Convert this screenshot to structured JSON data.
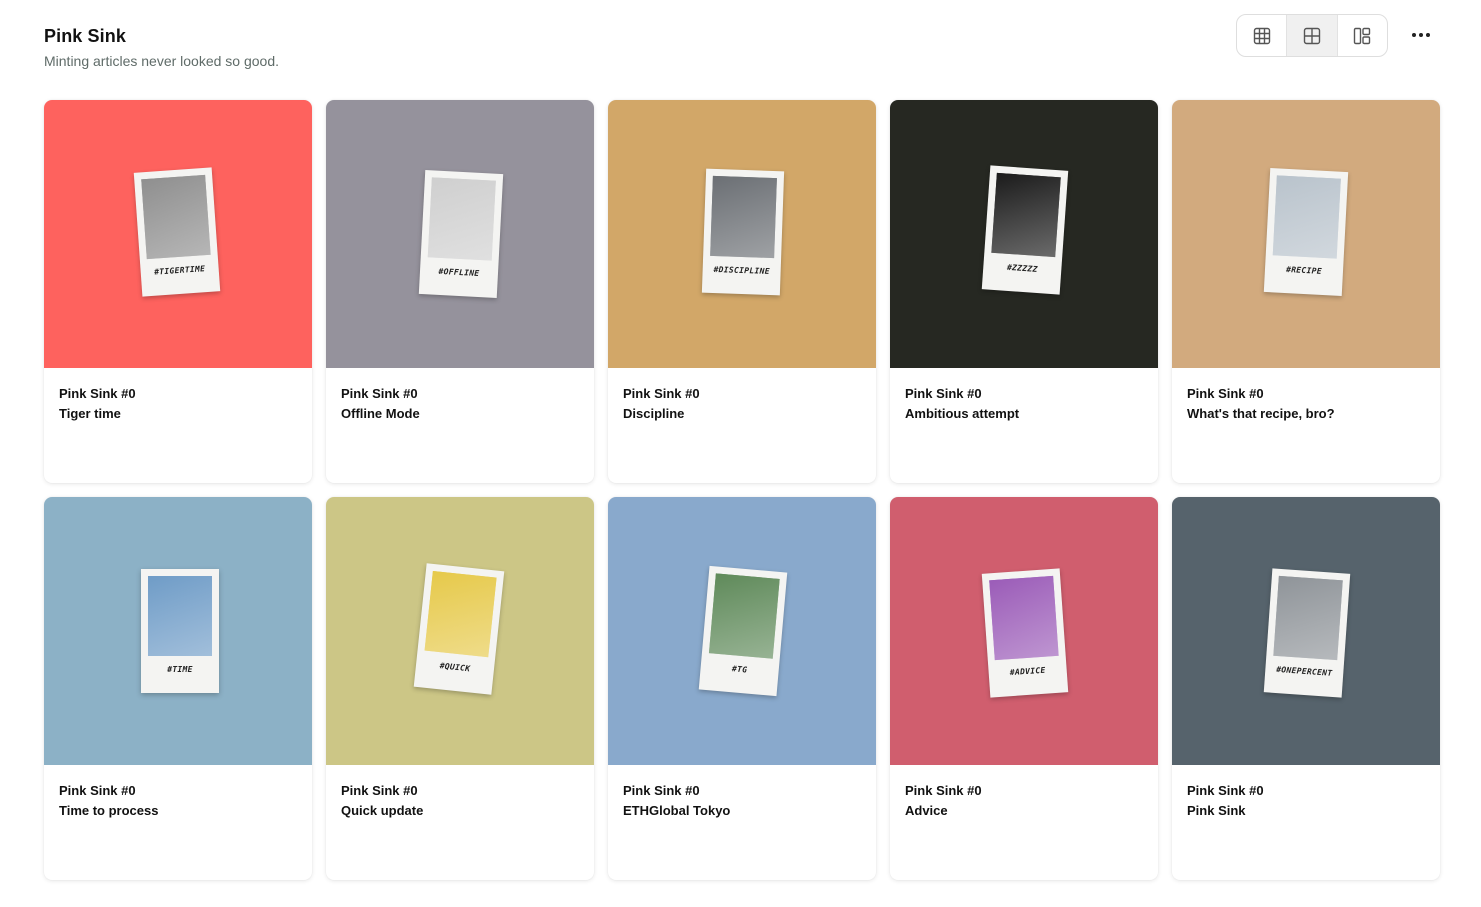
{
  "header": {
    "title": "Pink Sink",
    "subtitle": "Minting articles never looked so good."
  },
  "toolbar": {
    "views": [
      {
        "icon": "grid-small-icon"
      },
      {
        "icon": "grid-large-icon",
        "active": true
      },
      {
        "icon": "layout-icon"
      }
    ],
    "more_icon": "more-dots-icon"
  },
  "cards": [
    {
      "series": "Pink Sink #0",
      "name": "Tiger time",
      "tag": "#TIGERTIME",
      "bg": "#fe625e",
      "photo": "#8f8f8f"
    },
    {
      "series": "Pink Sink #0",
      "name": "Offline Mode",
      "tag": "#OFFLINE",
      "bg": "#95929c",
      "photo": "#cfcfcf"
    },
    {
      "series": "Pink Sink #0",
      "name": "Discipline",
      "tag": "#DISCIPLINE",
      "bg": "#d2a768",
      "photo": "#6b6f74"
    },
    {
      "series": "Pink Sink #0",
      "name": "Ambitious attempt",
      "tag": "#ZZZZZ",
      "bg": "#262822",
      "photo": "#1b1b1b"
    },
    {
      "series": "Pink Sink #0",
      "name": "What's that recipe, bro?",
      "tag": "#RECIPE",
      "bg": "#d2aa7e",
      "photo": "#b9c3cc"
    },
    {
      "series": "Pink Sink #0",
      "name": "Time to process",
      "tag": "#TIME",
      "bg": "#8cb1c6",
      "photo": "#6f9cc7"
    },
    {
      "series": "Pink Sink #0",
      "name": "Quick update",
      "tag": "#QUICK",
      "bg": "#ccc686",
      "photo": "#e6c94a"
    },
    {
      "series": "Pink Sink #0",
      "name": "ETHGlobal Tokyo",
      "tag": "#TG",
      "bg": "#89a9cc",
      "photo": "#5f8a5a"
    },
    {
      "series": "Pink Sink #0",
      "name": "Advice",
      "tag": "#ADVICE",
      "bg": "#d05e6e",
      "photo": "#9b5cb8"
    },
    {
      "series": "Pink Sink #0",
      "name": "Pink Sink",
      "tag": "#ONEPERCENT",
      "bg": "#56636c",
      "photo": "#8f9499"
    }
  ]
}
